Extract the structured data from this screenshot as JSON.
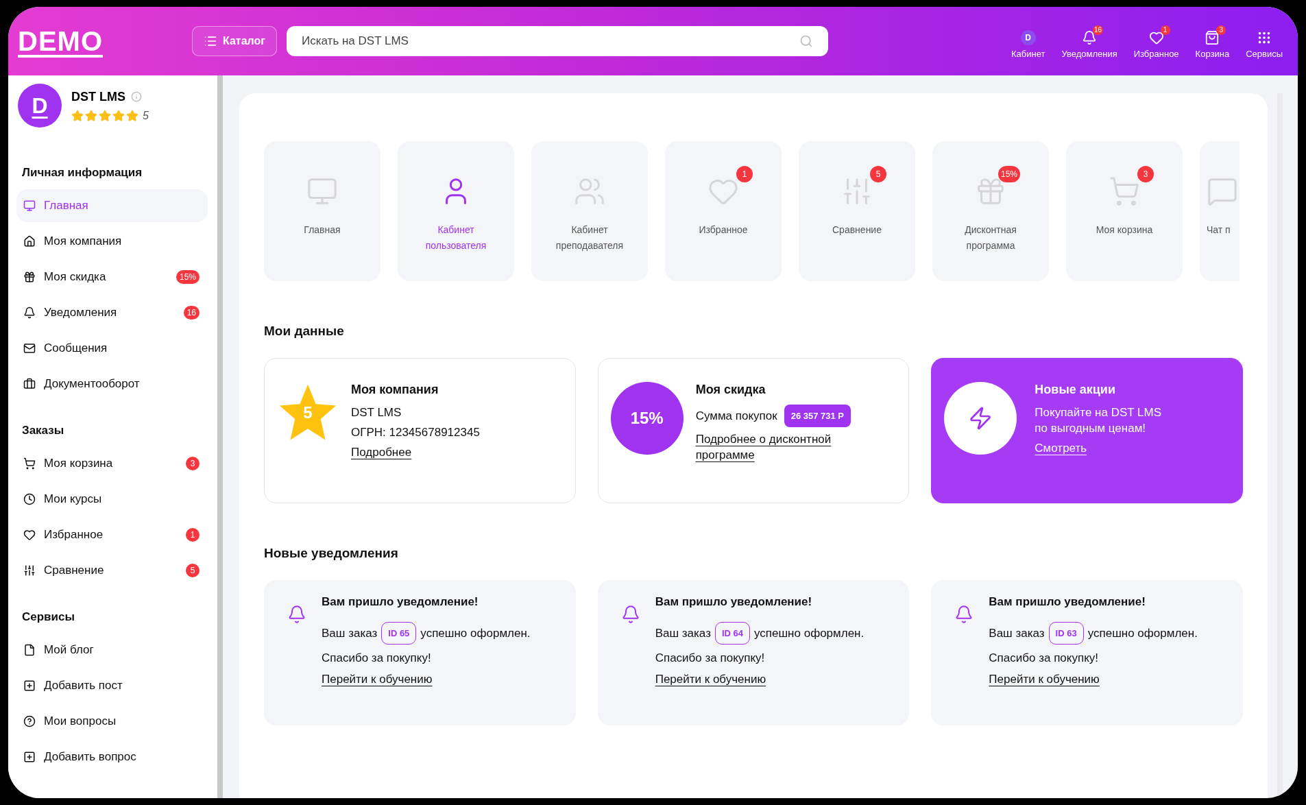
{
  "header": {
    "logo": "DEMO",
    "catalog_button": "Каталог",
    "search": {
      "placeholder": "Искать на DST LMS"
    },
    "nav": [
      {
        "label": "Кабинет",
        "avatar_letter": "D"
      },
      {
        "label": "Уведомления",
        "badge": "16"
      },
      {
        "label": "Избранное",
        "badge": "1"
      },
      {
        "label": "Корзина",
        "badge": "3"
      },
      {
        "label": "Сервисы"
      }
    ]
  },
  "profile": {
    "avatar_letter": "D",
    "name": "DST LMS",
    "stars": 5,
    "rating": "5"
  },
  "sidebar": [
    {
      "title": "Личная информация",
      "items": [
        {
          "label": "Главная",
          "selected": true
        },
        {
          "label": "Моя компания",
          "selected": false
        },
        {
          "label": "Моя скидка",
          "badge": "15%",
          "selected": false
        },
        {
          "label": "Уведомления",
          "badge": "16",
          "selected": false
        },
        {
          "label": "Сообщения",
          "selected": false
        },
        {
          "label": "Документооборот",
          "selected": false
        }
      ]
    },
    {
      "title": "Заказы",
      "items": [
        {
          "label": "Моя корзина",
          "badge": "3",
          "selected": false
        },
        {
          "label": "Мои курсы",
          "selected": false
        },
        {
          "label": "Избранное",
          "badge": "1",
          "selected": false
        },
        {
          "label": "Сравнение",
          "badge": "5",
          "selected": false
        }
      ]
    },
    {
      "title": "Сервисы",
      "items": [
        {
          "label": "Мой блог",
          "selected": false
        },
        {
          "label": "Добавить пост",
          "selected": false
        },
        {
          "label": "Мои вопросы",
          "selected": false
        },
        {
          "label": "Добавить вопрос",
          "selected": false
        }
      ]
    }
  ],
  "tiles": [
    {
      "label": "Главная",
      "kind": "full",
      "selected": false
    },
    {
      "label": "Кабинет пользователя",
      "kind": "full",
      "selected": true
    },
    {
      "label": "Кабинет преподавателя",
      "kind": "full",
      "selected": false
    },
    {
      "label": "Избранное",
      "kind": "full",
      "badge": "1",
      "selected": false
    },
    {
      "label": "Сравнение",
      "kind": "full",
      "badge": "5",
      "selected": false
    },
    {
      "label": "Дисконтная программа",
      "kind": "full",
      "badge": "15%",
      "selected": false
    },
    {
      "label": "Моя корзина",
      "kind": "full",
      "badge": "3",
      "selected": false
    },
    {
      "label": "Чат п",
      "kind": "partial",
      "selected": false
    }
  ],
  "my_data": {
    "title": "Мои данные",
    "company": {
      "score": "5",
      "title": "Моя компания",
      "lines": [
        "DST LMS",
        "ОГРН: 12345678912345"
      ],
      "link": "Подробнее"
    },
    "discount": {
      "percent": "15%",
      "title": "Моя скидка",
      "label": "Сумма покупок",
      "amount": "26 357 731 Р",
      "link": "Подробнее о дисконтной программе"
    },
    "promo": {
      "title": "Новые акции",
      "text": "Покупайте на DST LMS по выгодным ценам!",
      "link": "Смотреть"
    }
  },
  "notifications": {
    "title": "Новые уведомления",
    "items": [
      {
        "title": "Вам пришло уведомление!",
        "prefix": "Ваш заказ",
        "order_id": "ID 65",
        "suffix": "успешно оформлен.",
        "thanks": "Спасибо за покупку!",
        "link": "Перейти к обучению"
      },
      {
        "title": "Вам пришло уведомление!",
        "prefix": "Ваш заказ",
        "order_id": "ID 64",
        "suffix": "успешно оформлен.",
        "thanks": "Спасибо за покупку!",
        "link": "Перейти к обучению"
      },
      {
        "title": "Вам пришло уведомление!",
        "prefix": "Ваш заказ",
        "order_id": "ID 63",
        "suffix": "успешно оформлен.",
        "thanks": "Спасибо за покупку!",
        "link": "Перейти к обучению"
      }
    ]
  }
}
